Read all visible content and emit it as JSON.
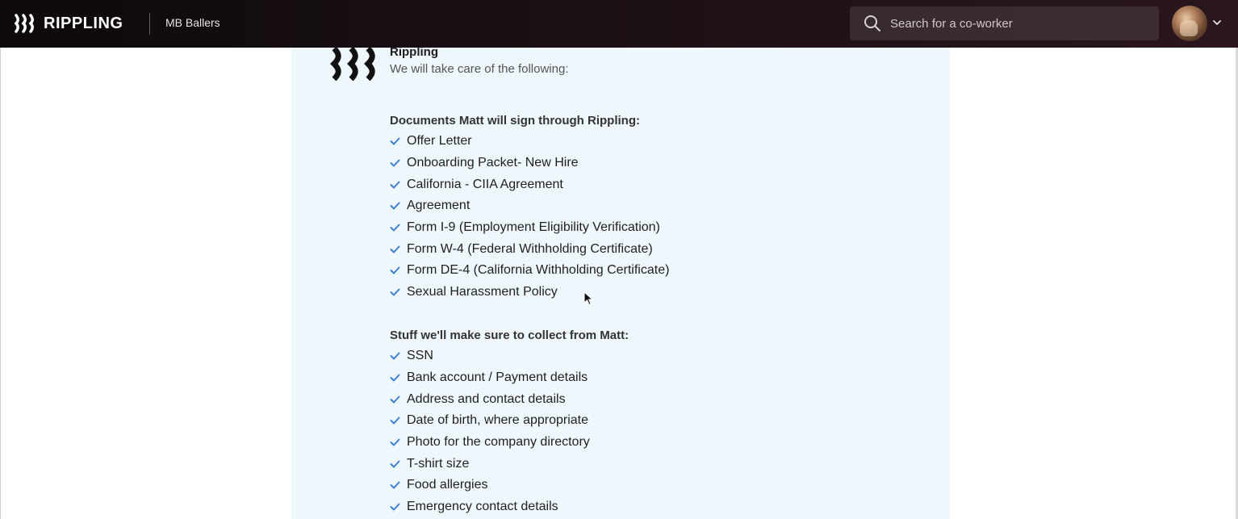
{
  "header": {
    "brand": "RIPPLING",
    "company": "MB Ballers",
    "search": {
      "placeholder": "Search for a co-worker"
    },
    "icons": {
      "search": "search-icon",
      "avatar": "user-avatar",
      "menu": "chevron-down-icon"
    }
  },
  "message": {
    "sender": "Rippling",
    "intro": "We will take care of the following:",
    "documents_title": "Documents Matt will sign through Rippling:",
    "documents": [
      "Offer Letter",
      "Onboarding Packet- New Hire",
      "California - CIIA Agreement",
      "Agreement",
      "Form I-9 (Employment Eligibility Verification)",
      "Form W-4 (Federal Withholding Certificate)",
      "Form DE-4 (California Withholding Certificate)",
      "Sexual Harassment Policy"
    ],
    "collect_title": "Stuff we'll make sure to collect from Matt:",
    "collect": [
      "SSN",
      "Bank account / Payment details",
      "Address and contact details",
      "Date of birth, where appropriate",
      "Photo for the company directory",
      "T-shirt size",
      "Food allergies",
      "Emergency contact details"
    ]
  },
  "colors": {
    "topbar": "#1a1015",
    "panel": "#eef7fb",
    "check": "#3f7fd6"
  }
}
